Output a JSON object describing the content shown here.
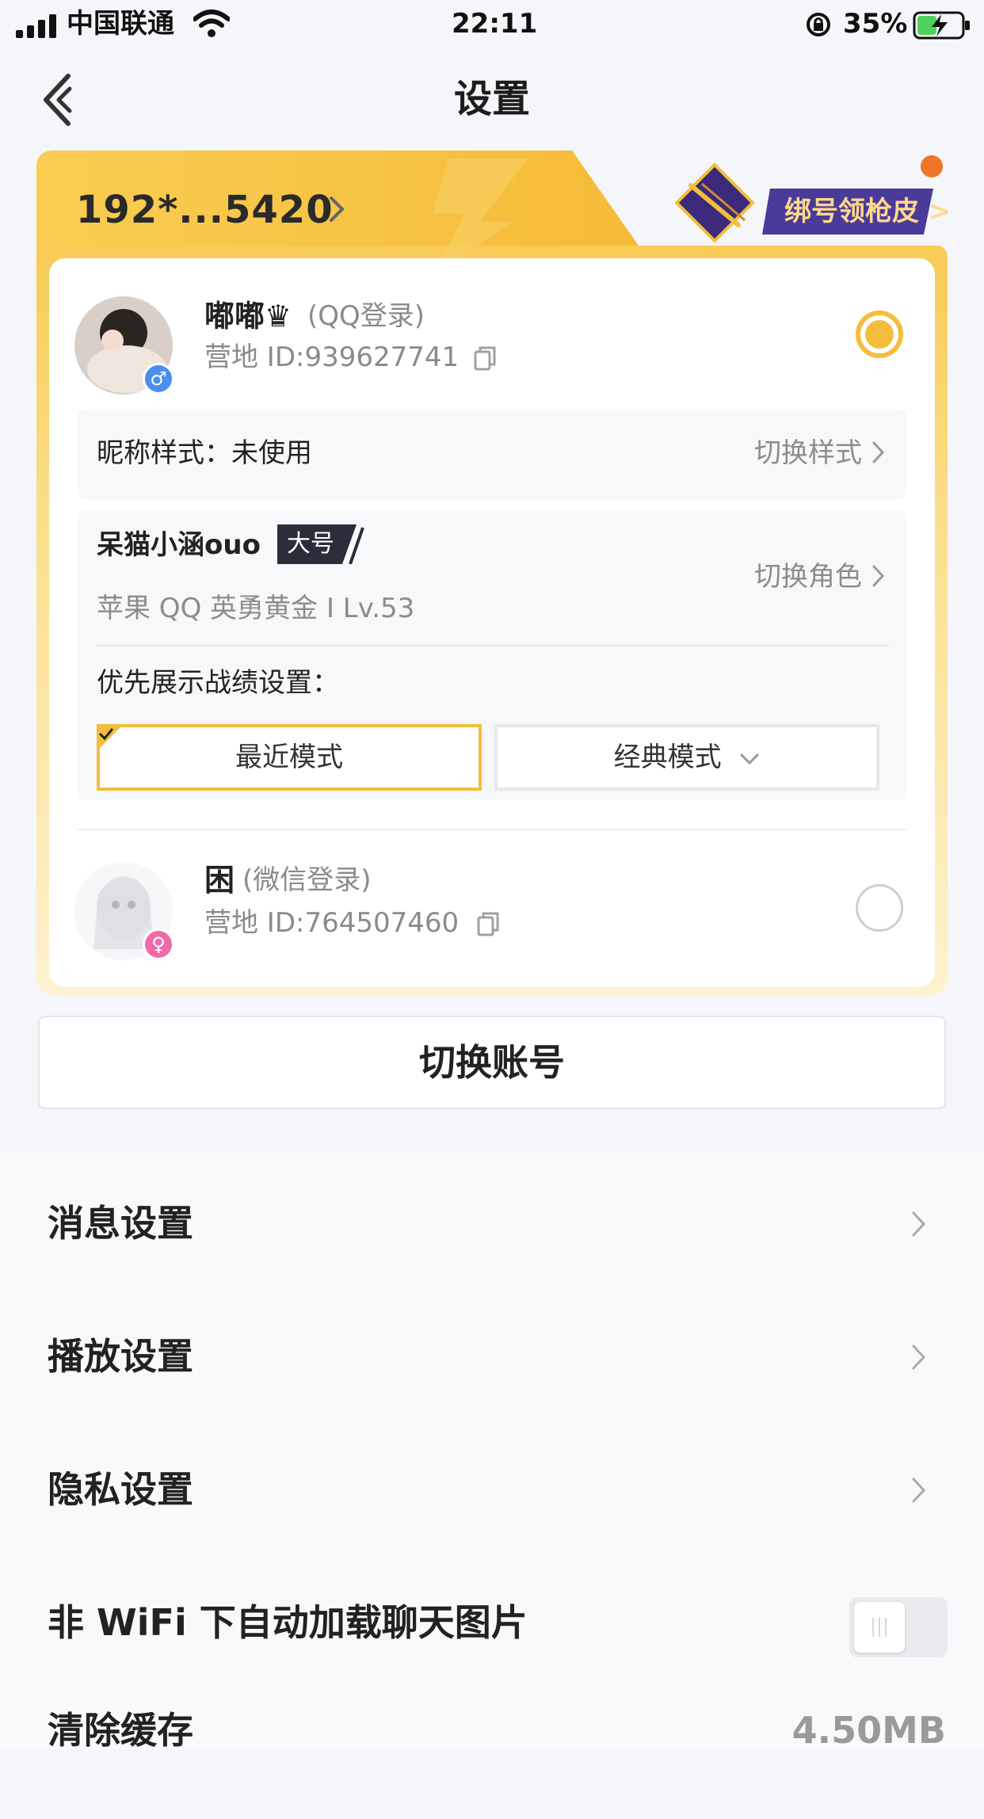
{
  "status_bar": {
    "carrier": "中国联通",
    "time": "22:11",
    "battery_percent": "35%"
  },
  "nav": {
    "title": "设置"
  },
  "account_card": {
    "phone": "192*...5420",
    "bind_banner_label": "绑号领枪皮 >",
    "accounts": [
      {
        "name": "嘟嘟♛",
        "login": "(QQ登录)",
        "camp_id": "营地 ID:939627741",
        "gender": "male",
        "selected": true
      },
      {
        "name": "困",
        "login": "(微信登录)",
        "camp_id": "营地 ID:764507460",
        "gender": "female",
        "selected": false
      }
    ],
    "nickname_style_label": "昵称样式：未使用",
    "nickname_style_action": "切换样式",
    "role_name": "呆猫小涵ouo",
    "role_badge": "大号",
    "role_detail": "苹果 QQ  英勇黄金 I  Lv.53",
    "role_action": "切换角色",
    "priority_label": "优先展示战绩设置：",
    "modes": [
      "最近模式",
      "经典模式"
    ],
    "selected_mode": "最近模式"
  },
  "switch_account_label": "切换账号",
  "settings": [
    {
      "label": "消息设置",
      "type": "link"
    },
    {
      "label": "播放设置",
      "type": "link"
    },
    {
      "label": "隐私设置",
      "type": "link"
    },
    {
      "label": "非 WiFi 下自动加载聊天图片",
      "type": "toggle",
      "on": false
    },
    {
      "label": "清除缓存",
      "value": "4.50MB",
      "type": "value"
    }
  ],
  "colors": {
    "accent_yellow": "#f3be3c",
    "banner_purple": "#4a3a9a",
    "male_blue": "#4a8ff0",
    "female_pink": "#f06aa8",
    "notice_dot": "#f0742a"
  }
}
